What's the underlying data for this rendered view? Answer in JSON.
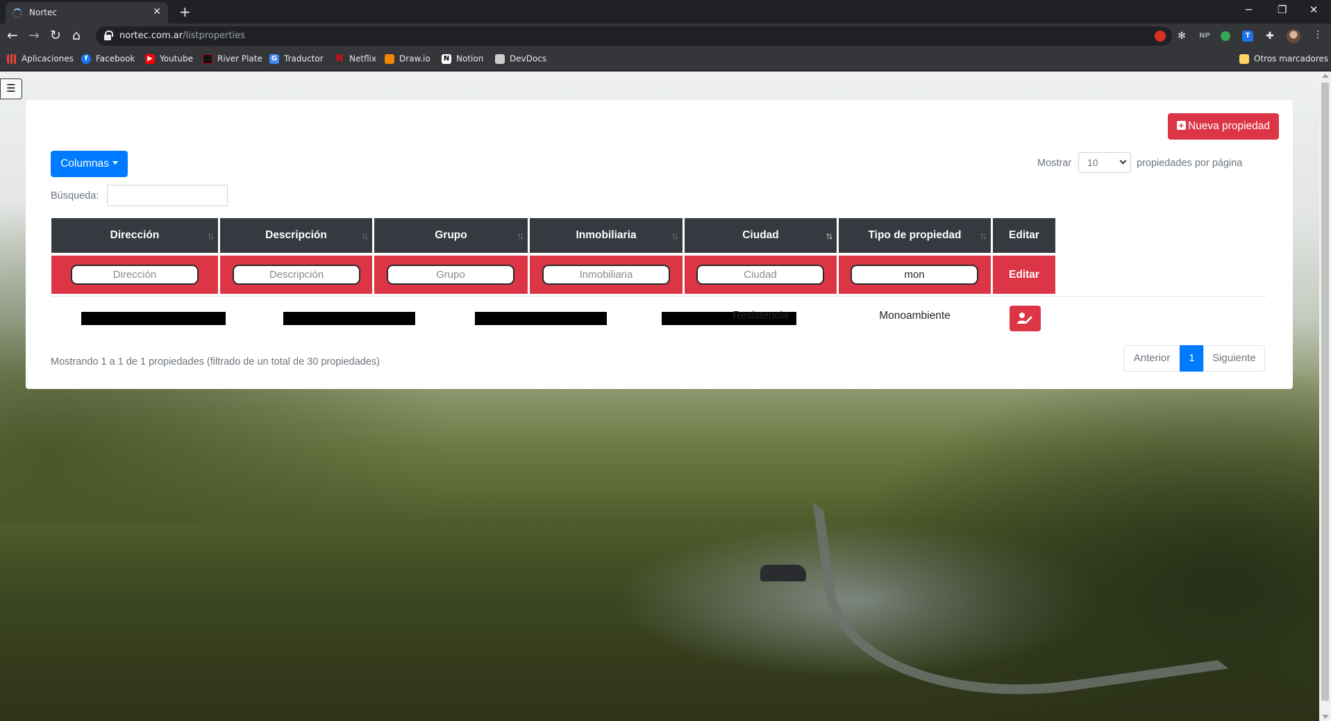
{
  "browser": {
    "tab_title": "Nortec",
    "url_host": "nortec.com.ar",
    "url_path": "/listproperties",
    "bookmarks": [
      "Aplicaciones",
      "Facebook",
      "Youtube",
      "River Plate",
      "Traductor",
      "Netflix",
      "Draw.io",
      "Notion",
      "DevDocs"
    ],
    "other_bookmarks": "Otros marcadores",
    "extension_np": "NP"
  },
  "page": {
    "new_button_label": "Nueva propiedad",
    "columns_button_label": "Columnas",
    "show_label": "Mostrar",
    "page_size": "10",
    "per_page_label": "propiedades por página",
    "search_label": "Búsqueda:",
    "search_value": "",
    "columns": [
      "Dirección",
      "Descripción",
      "Grupo",
      "Inmobiliaria",
      "Ciudad",
      "Tipo de propiedad",
      "Editar"
    ],
    "filters": {
      "direccion_placeholder": "Dirección",
      "descripcion_placeholder": "Descripción",
      "grupo_placeholder": "Grupo",
      "inmobiliaria_placeholder": "Inmobiliaria",
      "ciudad_placeholder": "Ciudad",
      "tipo_value": "mon",
      "edit_label": "Editar"
    },
    "rows": [
      {
        "ciudad": "Resistencia",
        "tipo": "Monoambiente"
      }
    ],
    "info_text": "Mostrando 1 a 1 de 1 propiedades (filtrado de un total de 30 propiedades)",
    "pagination": {
      "prev": "Anterior",
      "current": "1",
      "next": "Siguiente"
    }
  },
  "colors": {
    "danger": "#dc3545",
    "primary": "#007bff",
    "header": "#343a40"
  }
}
